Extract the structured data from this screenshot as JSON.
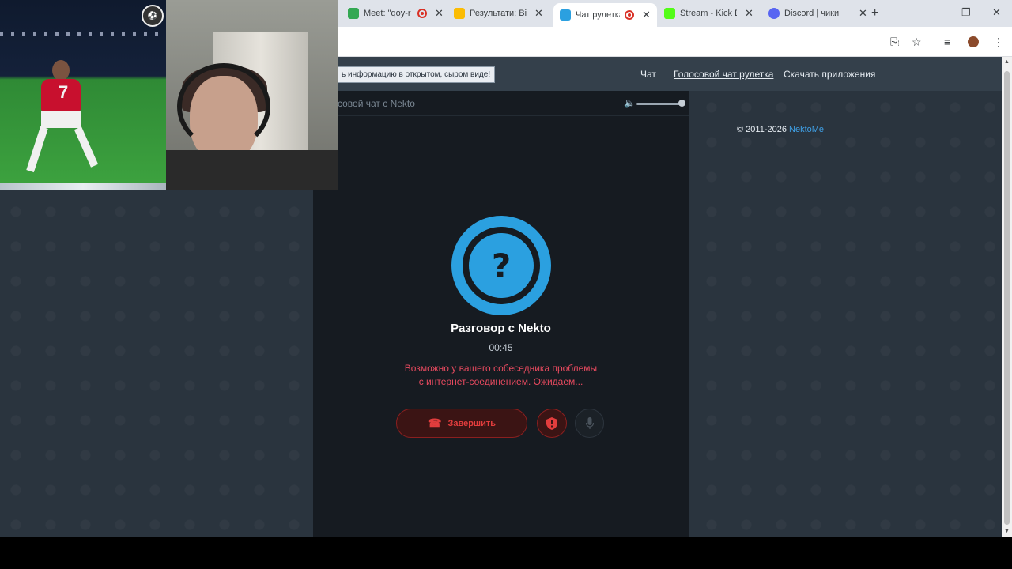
{
  "browser": {
    "tabs": [
      {
        "title": "Meet: \"qoy-r",
        "recording": true,
        "favicon_color": "#34a853"
      },
      {
        "title": "Результати: Від",
        "recording": false,
        "favicon_color": "#fbbc04"
      },
      {
        "title": "Чат рулетка",
        "recording": true,
        "favicon_color": "#2ba0e0",
        "active": true
      },
      {
        "title": "Stream - Kick De",
        "recording": false,
        "favicon_color": "#53fc18"
      },
      {
        "title": "Discord | чики",
        "recording": false,
        "favicon_color": "#5865f2"
      }
    ],
    "new_tab": "+",
    "controls": {
      "minimize": "—",
      "restore": "❐",
      "close": "✕"
    }
  },
  "site": {
    "notice": "ь информацию в открытом, сыром виде!",
    "nav": {
      "chat": "Чат",
      "voice_roulette": "Голосовой чат рулетка",
      "download": "Скачать приложения"
    },
    "panel_title": "совой чат с Nekto",
    "conversation": {
      "title": "Разговор с Nekto",
      "timer": "00:45",
      "warning_line1": "Возможно у вашего собеседника проблемы",
      "warning_line2": "с интернет-соединением. Ожидаем...",
      "end_label": "Завершить",
      "avatar_symbol": "?"
    },
    "copyright": "© 2011-2026 ",
    "copyright_link": "NektoMe",
    "volume_level": 0.95
  },
  "colors": {
    "accent": "#2ba0e0",
    "danger": "#e23d3d",
    "warning_text": "#e84a5f",
    "panel_bg": "#161b21",
    "page_bg": "#2a343e"
  },
  "overlay": {
    "video1_jersey_number": "7"
  }
}
